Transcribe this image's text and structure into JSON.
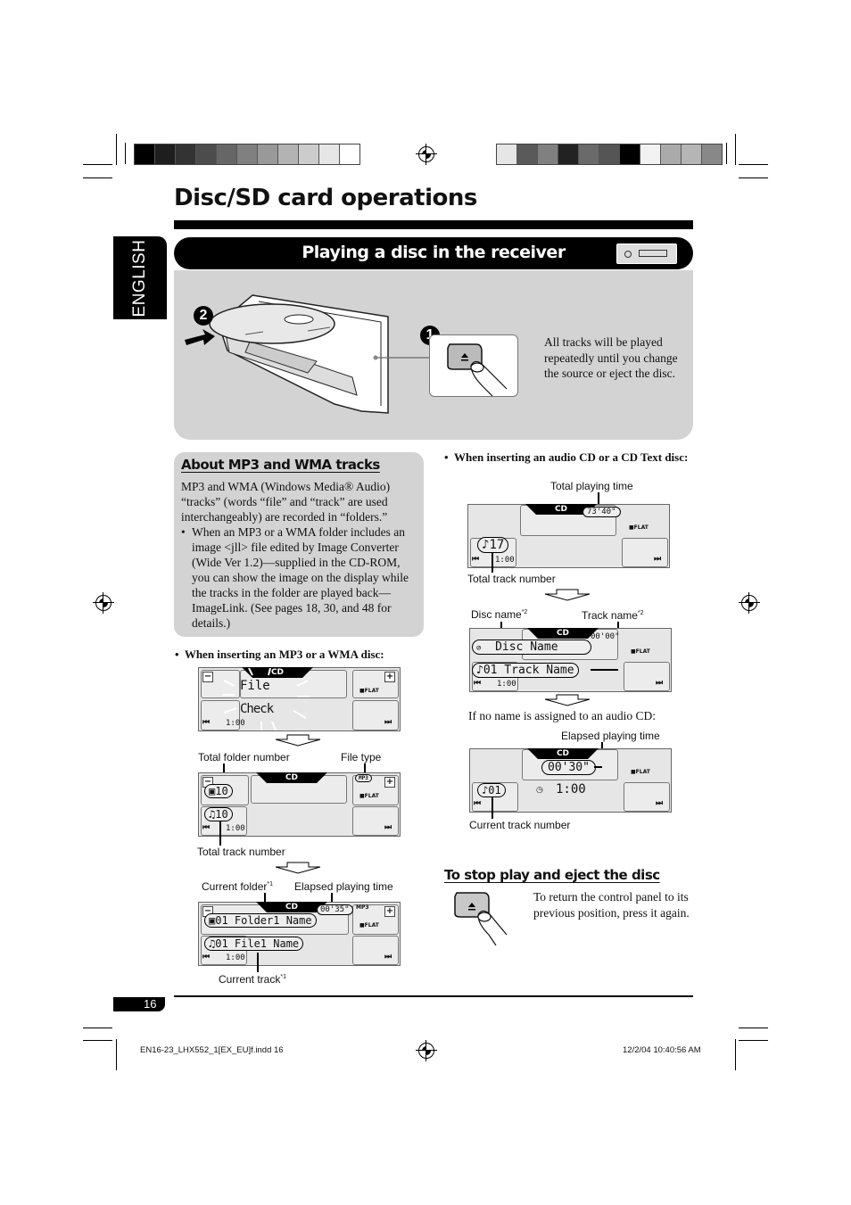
{
  "page": {
    "title": "Disc/SD card operations",
    "language_tab": "ENGLISH",
    "section_title": "Playing a disc in the receiver",
    "page_number": "16"
  },
  "color_bars": {
    "left": [
      "#000000",
      "#1e1e1e",
      "#333333",
      "#4c4c4c",
      "#666666",
      "#808080",
      "#999999",
      "#b3b3b3",
      "#cccccc",
      "#e6e6e6",
      "#ffffff"
    ],
    "right": [
      "#e6e6e6",
      "#5a5a5a",
      "#808080",
      "#222222",
      "#6a6a6a",
      "#555555",
      "#000000",
      "#f2f2f2",
      "#aaaaaa",
      "#b5b5b5",
      "#888888"
    ]
  },
  "illustration": {
    "step1": "1",
    "step2": "2",
    "note": "All tracks will be played repeatedly until you change the source or eject the disc."
  },
  "mp3_box": {
    "heading": "About MP3 and WMA tracks",
    "intro": "MP3 and WMA (Windows Media® Audio) “tracks” (words “file” and “track” are used interchangeably) are recorded in “folders.”",
    "bullet": "When an MP3 or a WMA folder includes an image <jll> file edited by Image Converter (Wide Ver 1.2)—supplied in the CD-ROM, you can show the image on the display while the tracks in the folder are played back—ImageLink. (See pages 18, 30, and 48 for details.)"
  },
  "mp3_section": {
    "heading": "When inserting an MP3 or a WMA disc:",
    "display1": {
      "mode": "CD",
      "line1": "File",
      "line2": "Check",
      "time": "1:00",
      "flat": "FLAT"
    },
    "display2": {
      "mode": "CD",
      "folder_count": "10",
      "track_count": "10",
      "file_type": "MP3",
      "time": "1:00",
      "flat": "FLAT",
      "label_folder": "Total folder number",
      "label_type": "File type",
      "label_track": "Total track number"
    },
    "display3": {
      "mode": "CD",
      "folder_name": "01 Folder1 Name",
      "file_name": "01 File1 Name",
      "elapsed": "00'35\"",
      "file_type": "MP3",
      "time": "1:00",
      "flat": "FLAT",
      "label_folder": "Current folder",
      "label_folder_note": "*1",
      "label_elapsed": "Elapsed playing time",
      "label_track": "Current track",
      "label_track_note": "*1"
    }
  },
  "cd_section": {
    "heading": "When inserting an audio CD or a CD Text disc:",
    "display1": {
      "mode": "CD",
      "total_time": "73'40\"",
      "track_count": "17",
      "time": "1:00",
      "flat": "FLAT",
      "label_time": "Total playing time",
      "label_track": "Total track number"
    },
    "display2": {
      "mode": "CD",
      "disc_name": "Disc Name",
      "track_name": "01 Track Name",
      "elapsed": "00'00\"",
      "time": "1:00",
      "flat": "FLAT",
      "label_disc": "Disc name",
      "label_disc_note": "*2",
      "label_track": "Track name",
      "label_track_note": "*2"
    },
    "no_name_note": "If no name is assigned to an audio CD:",
    "display3": {
      "mode": "CD",
      "elapsed": "00'30\"",
      "current_track": "01",
      "clock": "1:00",
      "flat": "FLAT",
      "label_elapsed": "Elapsed playing time",
      "label_track": "Current track number"
    }
  },
  "eject_section": {
    "heading": "To stop play and eject the disc",
    "text": "To return the control panel to its previous position, press it again."
  },
  "footer": {
    "file": "EN16-23_LHX552_1[EX_EU]f.indd   16",
    "date": "12/2/04   10:40:56 AM"
  }
}
